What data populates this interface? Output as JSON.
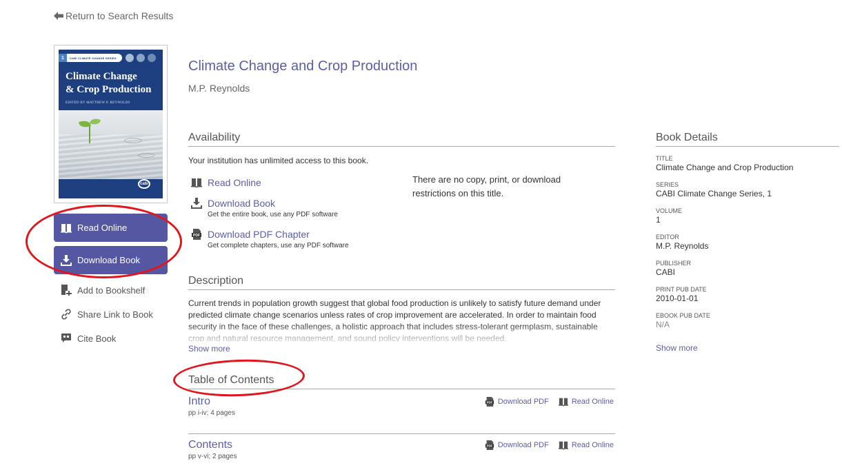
{
  "nav": {
    "back_label": "Return to Search Results"
  },
  "cover": {
    "series_number": "1",
    "series_banner": "CABI CLIMATE CHANGE SERIES",
    "title_line1": "Climate Change",
    "title_line2": "& Crop Production",
    "editor_line": "EDITED BY MATTHEW P. REYNOLDS",
    "publisher_logo": "cabi"
  },
  "actions": {
    "read_online": "Read Online",
    "download_book": "Download Book",
    "add_to_bookshelf": "Add to Bookshelf",
    "share_link": "Share Link to Book",
    "cite_book": "Cite Book"
  },
  "book": {
    "title": "Climate Change and Crop Production",
    "author": "M.P. Reynolds"
  },
  "availability": {
    "heading": "Availability",
    "note": "Your institution has unlimited access to this book.",
    "items": [
      {
        "label": "Read Online",
        "sub": "",
        "icon": "book-open-icon"
      },
      {
        "label": "Download Book",
        "sub": "Get the entire book, use any PDF software",
        "icon": "download-icon"
      },
      {
        "label": "Download PDF Chapter",
        "sub": "Get complete chapters, use any PDF software",
        "icon": "pdf-icon"
      }
    ],
    "restrictions": "There are no copy, print, or download restrictions on this title."
  },
  "description": {
    "heading": "Description",
    "text": "Current trends in population growth suggest that global food production is unlikely to satisfy future demand under predicted climate change scenarios unless rates of crop improvement are accelerated. In order to maintain food security in the face of these challenges, a holistic approach that includes stress-tolerant germplasm, sustainable crop and natural resource management, and sound policy interventions will be needed.",
    "show_more": "Show more"
  },
  "toc": {
    "heading": "Table of Contents",
    "download_label": "Download PDF",
    "read_label": "Read Online",
    "entries": [
      {
        "title": "Intro",
        "pages": "pp i-iv; 4 pages"
      },
      {
        "title": "Contents",
        "pages": "pp v-vi; 2 pages"
      }
    ]
  },
  "details": {
    "heading": "Book Details",
    "fields": [
      {
        "key": "TITLE",
        "value": "Climate Change and Crop Production"
      },
      {
        "key": "SERIES",
        "value": "CABI Climate Change Series, 1"
      },
      {
        "key": "VOLUME",
        "value": "1"
      },
      {
        "key": "EDITOR",
        "value": "M.P. Reynolds"
      },
      {
        "key": "PUBLISHER",
        "value": "CABI"
      },
      {
        "key": "PRINT PUB DATE",
        "value": "2010-01-01"
      },
      {
        "key": "EBOOK PUB DATE",
        "value": "N/A"
      }
    ],
    "show_more": "Show more"
  },
  "colors": {
    "brand": "#5657a3",
    "link": "#5b5ea6",
    "annotation": "#e2151d",
    "cover_blue": "#1d3f7f"
  }
}
